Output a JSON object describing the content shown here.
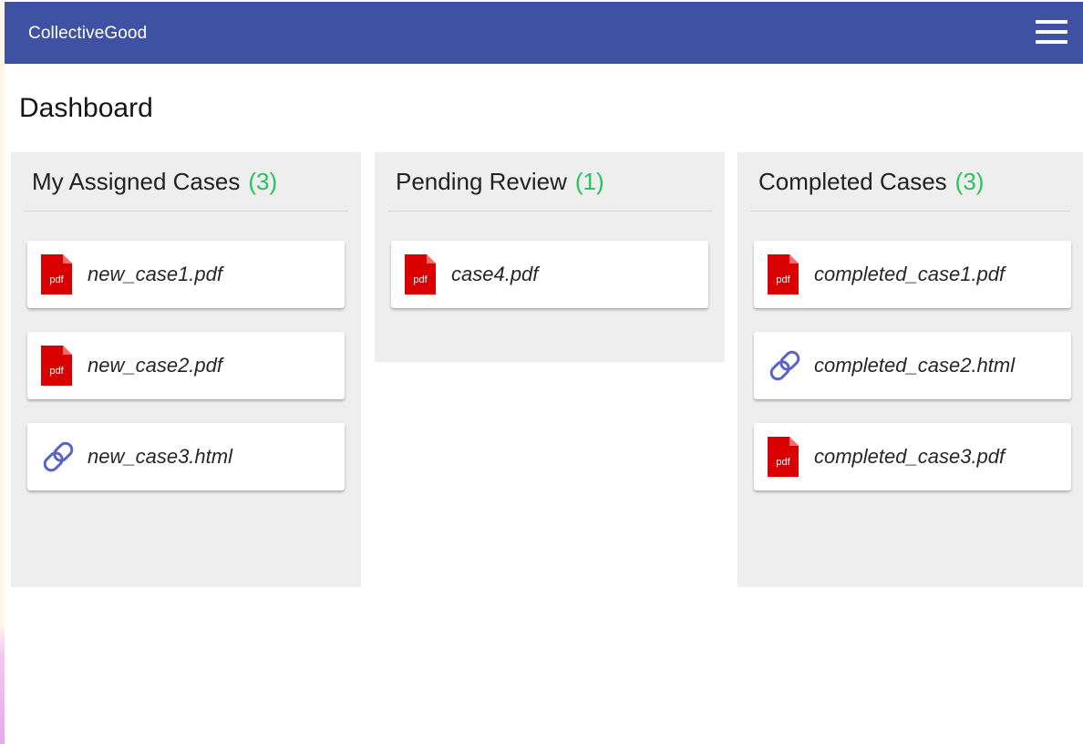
{
  "app": {
    "brand": "CollectiveGood",
    "menu_icon": "hamburger-menu-icon"
  },
  "page": {
    "title": "Dashboard"
  },
  "colors": {
    "app_bar": "#3f51a3",
    "count_accent": "#22c55e",
    "column_background": "#eeeeee",
    "pdf_icon": "#d80000",
    "link_icon": "#5963c8"
  },
  "columns": {
    "assigned": {
      "title": "My Assigned Cases",
      "count": "(3)",
      "cases": [
        {
          "name": "new_case1.pdf",
          "icon": "pdf-file-icon",
          "icon_label": "pdf"
        },
        {
          "name": "new_case2.pdf",
          "icon": "pdf-file-icon",
          "icon_label": "pdf"
        },
        {
          "name": "new_case3.html",
          "icon": "link-icon"
        }
      ]
    },
    "pending": {
      "title": "Pending Review",
      "count": "(1)",
      "cases": [
        {
          "name": "case4.pdf",
          "icon": "pdf-file-icon",
          "icon_label": "pdf"
        }
      ]
    },
    "completed": {
      "title": "Completed Cases",
      "count": "(3)",
      "cases": [
        {
          "name": "completed_case1.pdf",
          "icon": "pdf-file-icon",
          "icon_label": "pdf"
        },
        {
          "name": "completed_case2.html",
          "icon": "link-icon"
        },
        {
          "name": "completed_case3.pdf",
          "icon": "pdf-file-icon",
          "icon_label": "pdf"
        }
      ]
    }
  }
}
